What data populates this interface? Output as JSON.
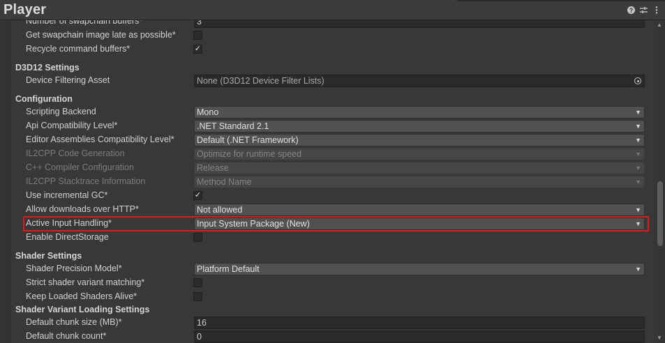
{
  "window": {
    "title": "Player"
  },
  "header": {
    "help_icon": "help-icon",
    "settings_icon": "sliders-icon",
    "menu_icon": "kebab-menu-icon"
  },
  "rows": {
    "swapchain_buffers": {
      "label": "Number of swapchain buffers*",
      "value": "3"
    },
    "swapchain_late": {
      "label": "Get swapchain image late as possible*",
      "checked": false
    },
    "recycle_buffers": {
      "label": "Recycle command buffers*",
      "checked": true,
      "mark": "✓"
    },
    "d3d12_header": "D3D12 Settings",
    "device_filtering": {
      "label": "Device Filtering Asset",
      "value": "None (D3D12 Device Filter Lists)"
    },
    "config_header": "Configuration",
    "scripting_backend": {
      "label": "Scripting Backend",
      "value": "Mono"
    },
    "api_compat": {
      "label": "Api Compatibility Level*",
      "value": ".NET Standard 2.1"
    },
    "editor_assemblies": {
      "label": "Editor Assemblies Compatibility Level*",
      "value": "Default (.NET Framework)"
    },
    "il2cpp_codegen": {
      "label": "IL2CPP Code Generation",
      "value": "Optimize for runtime speed"
    },
    "cpp_compiler": {
      "label": "C++ Compiler Configuration",
      "value": "Release"
    },
    "il2cpp_stacktrace": {
      "label": "IL2CPP Stacktrace Information",
      "value": "Method Name"
    },
    "incremental_gc": {
      "label": "Use incremental GC*",
      "checked": true,
      "mark": "✓"
    },
    "allow_http": {
      "label": "Allow downloads over HTTP*",
      "value": "Not allowed"
    },
    "active_input": {
      "label": "Active Input Handling*",
      "value": "Input System Package (New)"
    },
    "direct_storage": {
      "label": "Enable DirectStorage",
      "checked": false
    },
    "shader_header": "Shader Settings",
    "shader_precision": {
      "label": "Shader Precision Model*",
      "value": "Platform Default"
    },
    "strict_variant": {
      "label": "Strict shader variant matching*",
      "checked": false
    },
    "keep_shaders": {
      "label": "Keep Loaded Shaders Alive*",
      "checked": false
    },
    "variant_loading_header": "Shader Variant Loading Settings",
    "chunk_size": {
      "label": "Default chunk size (MB)*",
      "value": "16"
    },
    "chunk_count": {
      "label": "Default chunk count*",
      "value": "0"
    }
  },
  "dropdown_arrow": "▼",
  "colors": {
    "highlight": "#e01b1b",
    "background": "#383838"
  }
}
